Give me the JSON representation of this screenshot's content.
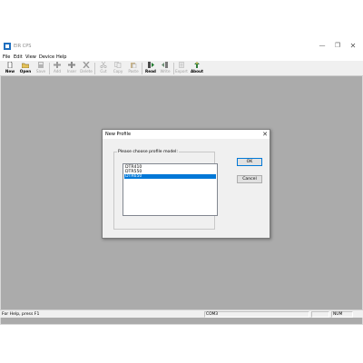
{
  "window": {
    "title": "EIR CPS"
  },
  "menu": [
    "File",
    "Edit",
    "View",
    "Device",
    "Help"
  ],
  "toolbar": [
    {
      "label": "New",
      "icon": "new-file-icon",
      "enabled": true
    },
    {
      "label": "Open",
      "icon": "open-folder-icon",
      "enabled": true
    },
    {
      "label": "Save",
      "icon": "save-icon",
      "enabled": false
    },
    {
      "label": "Add",
      "icon": "add-icon",
      "enabled": false
    },
    {
      "label": "Inser",
      "icon": "insert-icon",
      "enabled": false
    },
    {
      "label": "Delete",
      "icon": "delete-icon",
      "enabled": false
    },
    {
      "label": "Cut",
      "icon": "cut-icon",
      "enabled": false
    },
    {
      "label": "Copy",
      "icon": "copy-icon",
      "enabled": false
    },
    {
      "label": "Paste",
      "icon": "paste-icon",
      "enabled": false
    },
    {
      "label": "Read",
      "icon": "read-icon",
      "enabled": true
    },
    {
      "label": "Write",
      "icon": "write-icon",
      "enabled": false
    },
    {
      "label": "Export",
      "icon": "export-icon",
      "enabled": false
    },
    {
      "label": "About",
      "icon": "about-icon",
      "enabled": true
    }
  ],
  "dialog": {
    "title": "New Profile",
    "group_label": "Please choose profile model:",
    "models": [
      "DTR410",
      "DTR550",
      "DTR650"
    ],
    "selected": "DTR650",
    "ok_label": "OK",
    "cancel_label": "Cancel"
  },
  "status": {
    "help": "For Help, press F1",
    "port": "COM3",
    "num": "NUM"
  },
  "colors": {
    "workspace": "#ababab",
    "selection": "#0078d7",
    "chrome": "#f0f0f0"
  }
}
